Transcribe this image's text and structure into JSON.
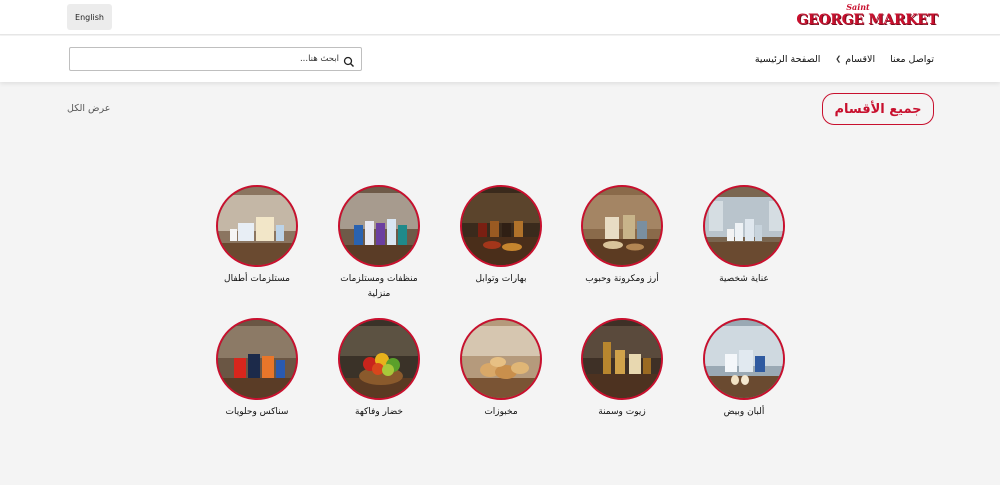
{
  "topbar": {
    "language_button": "English",
    "logo_saint": "Saint",
    "logo_main": "GEORGE MARKET"
  },
  "nav": {
    "home": "الصفحة الرئيسية",
    "sections": "الاقسام",
    "contact": "تواصل معنا"
  },
  "search": {
    "placeholder": "ابحث هنا..."
  },
  "section": {
    "title": "جميع الأقسام",
    "view_all": "عرض الكل"
  },
  "categories": [
    {
      "label": "عناية شخصية",
      "icon": "personal-care-image"
    },
    {
      "label": "أرز ومكرونة وحبوب",
      "icon": "rice-pasta-image"
    },
    {
      "label": "بهارات وتوابل",
      "icon": "spices-image"
    },
    {
      "label": "منظفات ومستلزمات منزلية",
      "icon": "cleaning-image"
    },
    {
      "label": "مستلزمات أطفال",
      "icon": "baby-supplies-image"
    },
    {
      "label": "ألبان وبيض",
      "icon": "dairy-eggs-image"
    },
    {
      "label": "زيوت وسمنة",
      "icon": "oils-ghee-image"
    },
    {
      "label": "مخبوزات",
      "icon": "bakery-image"
    },
    {
      "label": "خضار وفاكهة",
      "icon": "fruits-vegetables-image"
    },
    {
      "label": "سناكس وحلويات",
      "icon": "snacks-sweets-image"
    }
  ],
  "colors": {
    "accent": "#c8102e",
    "background": "#f4f4f4"
  }
}
